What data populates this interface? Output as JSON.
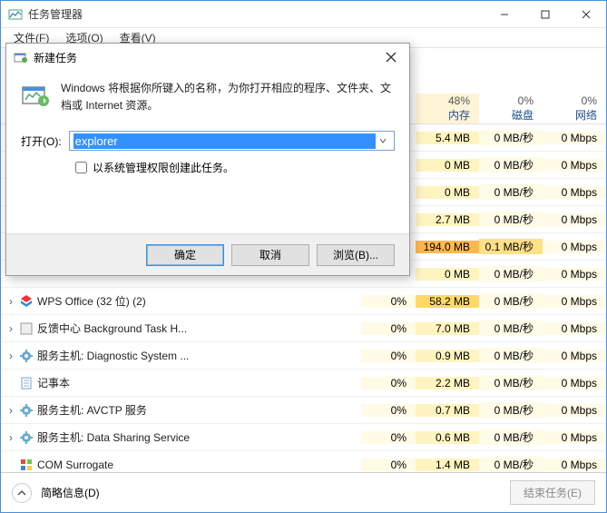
{
  "window": {
    "title": "任务管理器",
    "menu": {
      "file": "文件(F)",
      "options": "选项(O)",
      "view": "查看(V)"
    }
  },
  "columns": {
    "mem": {
      "pct": "48%",
      "label": "内存"
    },
    "disk": {
      "pct": "0%",
      "label": "磁盘"
    },
    "net": {
      "pct": "0%",
      "label": "网络"
    }
  },
  "rows": [
    {
      "cpu": "",
      "mem": "5.4 MB",
      "disk": "0 MB/秒",
      "net": "0 Mbps",
      "memLevel": 1
    },
    {
      "cpu": "",
      "mem": "0 MB",
      "disk": "0 MB/秒",
      "net": "0 Mbps",
      "memLevel": 1
    },
    {
      "cpu": "",
      "mem": "0 MB",
      "disk": "0 MB/秒",
      "net": "0 Mbps",
      "memLevel": 1
    },
    {
      "cpu": "",
      "mem": "2.7 MB",
      "disk": "0 MB/秒",
      "net": "0 Mbps",
      "memLevel": 1
    },
    {
      "cpu": "",
      "mem": "194.0 MB",
      "disk": "0.1 MB/秒",
      "net": "0 Mbps",
      "memLevel": 3,
      "diskLevel": 1
    },
    {
      "cpu": "",
      "mem": "0 MB",
      "disk": "0 MB/秒",
      "net": "0 Mbps",
      "memLevel": 1
    },
    {
      "name": "WPS Office (32 位) (2)",
      "expand": true,
      "icon": "wps",
      "cpu": "0%",
      "mem": "58.2 MB",
      "disk": "0 MB/秒",
      "net": "0 Mbps",
      "memLevel": 2
    },
    {
      "name": "反馈中心 Background Task H...",
      "expand": true,
      "icon": "app",
      "cpu": "0%",
      "mem": "7.0 MB",
      "disk": "0 MB/秒",
      "net": "0 Mbps",
      "memLevel": 1
    },
    {
      "name": "服务主机: Diagnostic System ...",
      "expand": true,
      "icon": "gear",
      "cpu": "0%",
      "mem": "0.9 MB",
      "disk": "0 MB/秒",
      "net": "0 Mbps",
      "memLevel": 1
    },
    {
      "name": "记事本",
      "expand": false,
      "icon": "notepad",
      "cpu": "0%",
      "mem": "2.2 MB",
      "disk": "0 MB/秒",
      "net": "0 Mbps",
      "memLevel": 1
    },
    {
      "name": "服务主机: AVCTP 服务",
      "expand": true,
      "icon": "gear",
      "cpu": "0%",
      "mem": "0.7 MB",
      "disk": "0 MB/秒",
      "net": "0 Mbps",
      "memLevel": 1
    },
    {
      "name": "服务主机: Data Sharing Service",
      "expand": true,
      "icon": "gear",
      "cpu": "0%",
      "mem": "0.6 MB",
      "disk": "0 MB/秒",
      "net": "0 Mbps",
      "memLevel": 1
    },
    {
      "name": "COM Surrogate",
      "expand": false,
      "icon": "com",
      "cpu": "0%",
      "mem": "1.4 MB",
      "disk": "0 MB/秒",
      "net": "0 Mbps",
      "memLevel": 1
    }
  ],
  "footer": {
    "less": "简略信息(D)",
    "end": "结束任务(E)"
  },
  "dialog": {
    "title": "新建任务",
    "message": "Windows 将根据你所键入的名称，为你打开相应的程序、文件夹、文档或 Internet 资源。",
    "openLabel": "打开(O):",
    "value": "explorer",
    "checkbox": "以系统管理权限创建此任务。",
    "ok": "确定",
    "cancel": "取消",
    "browse": "浏览(B)..."
  }
}
